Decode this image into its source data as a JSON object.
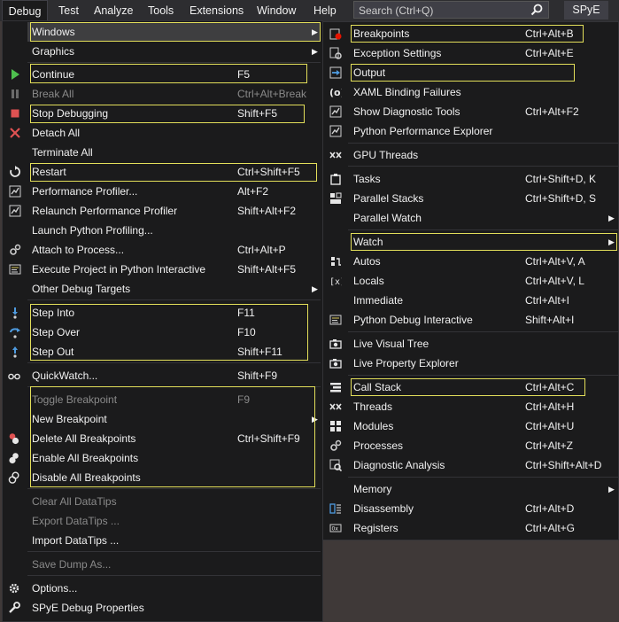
{
  "menubar": {
    "items": [
      "Debug",
      "Test",
      "Analyze",
      "Tools",
      "Extensions",
      "Window",
      "Help"
    ],
    "search_placeholder": "Search (Ctrl+Q)",
    "solution_badge": "SPyE"
  },
  "debug_menu": {
    "windows": "Windows",
    "graphics": "Graphics",
    "continue": {
      "label": "Continue",
      "shortcut": "F5"
    },
    "break_all": {
      "label": "Break All",
      "shortcut": "Ctrl+Alt+Break"
    },
    "stop_debugging": {
      "label": "Stop Debugging",
      "shortcut": "Shift+F5"
    },
    "detach_all": "Detach All",
    "terminate_all": "Terminate All",
    "restart": {
      "label": "Restart",
      "shortcut": "Ctrl+Shift+F5"
    },
    "performance_profiler": {
      "label": "Performance Profiler...",
      "shortcut": "Alt+F2"
    },
    "relaunch_profiler": {
      "label": "Relaunch Performance Profiler",
      "shortcut": "Shift+Alt+F2"
    },
    "launch_python_profiling": "Launch Python Profiling...",
    "attach_to_process": {
      "label": "Attach to Process...",
      "shortcut": "Ctrl+Alt+P"
    },
    "execute_python_interactive": {
      "label": "Execute Project in Python Interactive",
      "shortcut": "Shift+Alt+F5"
    },
    "other_debug_targets": "Other Debug Targets",
    "step_into": {
      "label": "Step Into",
      "shortcut": "F11"
    },
    "step_over": {
      "label": "Step Over",
      "shortcut": "F10"
    },
    "step_out": {
      "label": "Step Out",
      "shortcut": "Shift+F11"
    },
    "quickwatch": {
      "label": "QuickWatch...",
      "shortcut": "Shift+F9"
    },
    "toggle_breakpoint": {
      "label": "Toggle Breakpoint",
      "shortcut": "F9"
    },
    "new_breakpoint": "New Breakpoint",
    "delete_all_breakpoints": {
      "label": "Delete All Breakpoints",
      "shortcut": "Ctrl+Shift+F9"
    },
    "enable_all_breakpoints": "Enable All Breakpoints",
    "disable_all_breakpoints": "Disable All Breakpoints",
    "clear_all_datatips": "Clear All DataTips",
    "export_datatips": "Export DataTips ...",
    "import_datatips": "Import DataTips ...",
    "save_dump_as": "Save Dump As...",
    "options": "Options...",
    "spye_debug_properties": "SPyE Debug Properties"
  },
  "windows_menu": {
    "breakpoints": {
      "label": "Breakpoints",
      "shortcut": "Ctrl+Alt+B"
    },
    "exception_settings": {
      "label": "Exception Settings",
      "shortcut": "Ctrl+Alt+E"
    },
    "output": "Output",
    "xaml_binding_failures": "XAML Binding Failures",
    "show_diagnostic_tools": {
      "label": "Show Diagnostic Tools",
      "shortcut": "Ctrl+Alt+F2"
    },
    "python_performance_explorer": "Python Performance Explorer",
    "gpu_threads": "GPU Threads",
    "tasks": {
      "label": "Tasks",
      "shortcut": "Ctrl+Shift+D, K"
    },
    "parallel_stacks": {
      "label": "Parallel Stacks",
      "shortcut": "Ctrl+Shift+D, S"
    },
    "parallel_watch": "Parallel Watch",
    "watch": "Watch",
    "autos": {
      "label": "Autos",
      "shortcut": "Ctrl+Alt+V, A"
    },
    "locals": {
      "label": "Locals",
      "shortcut": "Ctrl+Alt+V, L"
    },
    "immediate": {
      "label": "Immediate",
      "shortcut": "Ctrl+Alt+I"
    },
    "python_debug_interactive": {
      "label": "Python Debug Interactive",
      "shortcut": "Shift+Alt+I"
    },
    "live_visual_tree": "Live Visual Tree",
    "live_property_explorer": "Live Property Explorer",
    "call_stack": {
      "label": "Call Stack",
      "shortcut": "Ctrl+Alt+C"
    },
    "threads": {
      "label": "Threads",
      "shortcut": "Ctrl+Alt+H"
    },
    "modules": {
      "label": "Modules",
      "shortcut": "Ctrl+Alt+U"
    },
    "processes": {
      "label": "Processes",
      "shortcut": "Ctrl+Alt+Z"
    },
    "diagnostic_analysis": {
      "label": "Diagnostic Analysis",
      "shortcut": "Ctrl+Shift+Alt+D"
    },
    "memory": "Memory",
    "disassembly": {
      "label": "Disassembly",
      "shortcut": "Ctrl+Alt+D"
    },
    "registers": {
      "label": "Registers",
      "shortcut": "Ctrl+Alt+G"
    }
  },
  "colors": {
    "highlight_box": "#e3df5a",
    "menu_bg": "#1b1b1c",
    "menubar_bg": "#2d2d30",
    "continue_green": "#4ec04e",
    "stop_red": "#e05252",
    "breakpoint_red": "#e51400"
  }
}
